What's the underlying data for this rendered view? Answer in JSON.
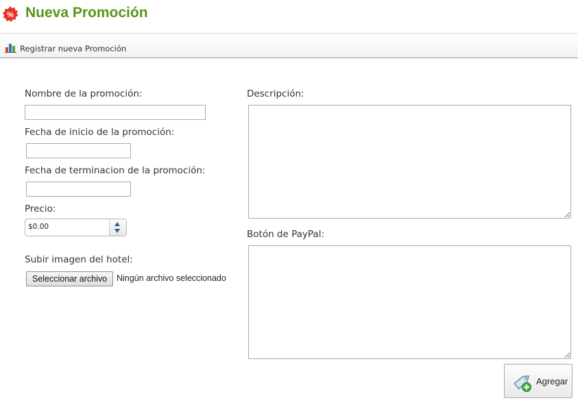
{
  "header": {
    "title": "Nueva Promoción",
    "badge_icon": "percent-badge-icon",
    "title_color": "#5a9416",
    "badge_color": "#e4332b"
  },
  "toolbar": {
    "icon": "bar-chart-icon",
    "link_label": "Registrar nueva Promoción"
  },
  "form": {
    "nombre_label": "Nombre de la promoción:",
    "nombre_value": "",
    "fecha_inicio_label": "Fecha de inicio de la promoción:",
    "fecha_inicio_value": "",
    "fecha_fin_label": "Fecha de terminacion de la promoción:",
    "fecha_fin_value": "",
    "precio_label": "Precio:",
    "precio_value": "$0.00",
    "imagen_label": "Subir imagen del hotel:",
    "file_button": "Seleccionar archivo",
    "file_status": "Ningún archivo seleccionado",
    "descripcion_label": "Descripción:",
    "descripcion_value": "",
    "paypal_label": "Botón de PayPal:",
    "paypal_value": "",
    "submit_label": "Agregar",
    "submit_icon": "tag-add-icon"
  }
}
